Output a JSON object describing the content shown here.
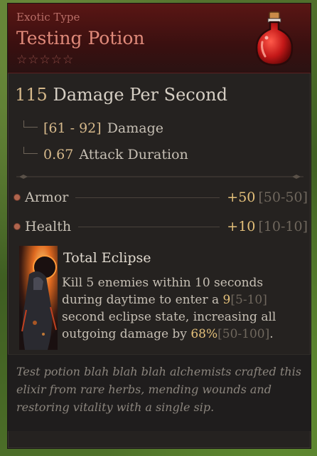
{
  "item": {
    "rarity": "Exotic Type",
    "name": "Testing Potion",
    "stars": "☆☆☆☆☆",
    "icon": "red-potion-icon"
  },
  "damage": {
    "dps_value": "115",
    "dps_label": "Damage Per Second",
    "range_value": "[61 - 92]",
    "range_label": "Damage",
    "duration_value": "0.67",
    "duration_label": "Attack Duration"
  },
  "stats": [
    {
      "label": "Armor",
      "bonus": "+50",
      "range": "[50-50]"
    },
    {
      "label": "Health",
      "bonus": "+10",
      "range": "[10-10]"
    }
  ],
  "ability": {
    "title": "Total Eclipse",
    "desc_a": "Kill 5 enemies within 10 seconds during daytime to enter a ",
    "hl1": "9",
    "rng1": "[5-10]",
    "desc_b": " second eclipse state, increasing all outgoing damage by ",
    "hl2": "68%",
    "rng2": "[50-100]",
    "desc_c": "."
  },
  "flavor": "Test potion blah blah blah alchemists crafted this elixir from rare herbs, mending wounds and restoring vitality with a single sip.",
  "colors": {
    "header_red": "#5a1614",
    "rarity_text": "#b86d66",
    "name_text": "#e08a7a",
    "value_gold": "#d6b98b",
    "bonus_gold": "#e4c07a",
    "panel_bg": "#252220"
  }
}
